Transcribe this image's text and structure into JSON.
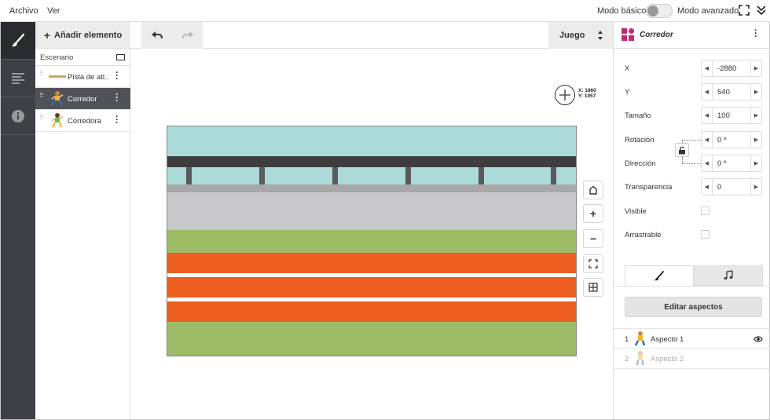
{
  "menu": {
    "archivo": "Archivo",
    "ver": "Ver"
  },
  "mode": {
    "basic": "Modo básico",
    "advanced": "Modo avanzado"
  },
  "sprites_panel": {
    "add_label": "Añadir elemento",
    "stage_label": "Escenario",
    "items": [
      {
        "name": "Pista de atl..."
      },
      {
        "name": "Corredor",
        "selected": true
      },
      {
        "name": "Corredora"
      }
    ]
  },
  "toolbar": {
    "mode_select": "Juego"
  },
  "canvas": {
    "coord_x": "X: 1860",
    "coord_y": "Y: 1057"
  },
  "props": {
    "title": "Corredor",
    "fields": [
      {
        "label": "X",
        "value": "-2880"
      },
      {
        "label": "Y",
        "value": "540"
      },
      {
        "label": "Tamaño",
        "value": "100"
      },
      {
        "label": "Rotación",
        "value": "0 º"
      },
      {
        "label": "Dirección",
        "value": "0 º"
      },
      {
        "label": "Transparencia",
        "value": "0"
      }
    ],
    "visible_label": "Visible",
    "draggable_label": "Arrastrable",
    "edit_button": "Editar aspectos",
    "aspects": [
      {
        "num": "1",
        "name": "Aspecto 1"
      },
      {
        "num": "2",
        "name": "Aspecto 2"
      }
    ]
  },
  "colors": {
    "sky": "#acdad8",
    "roof": "#3d3d3d",
    "concrete": "#c8c7c9",
    "grass": "#9ebb67",
    "track": "#ec5d1f",
    "toolcol": "#3e4046",
    "brand": "#c02a6e"
  }
}
